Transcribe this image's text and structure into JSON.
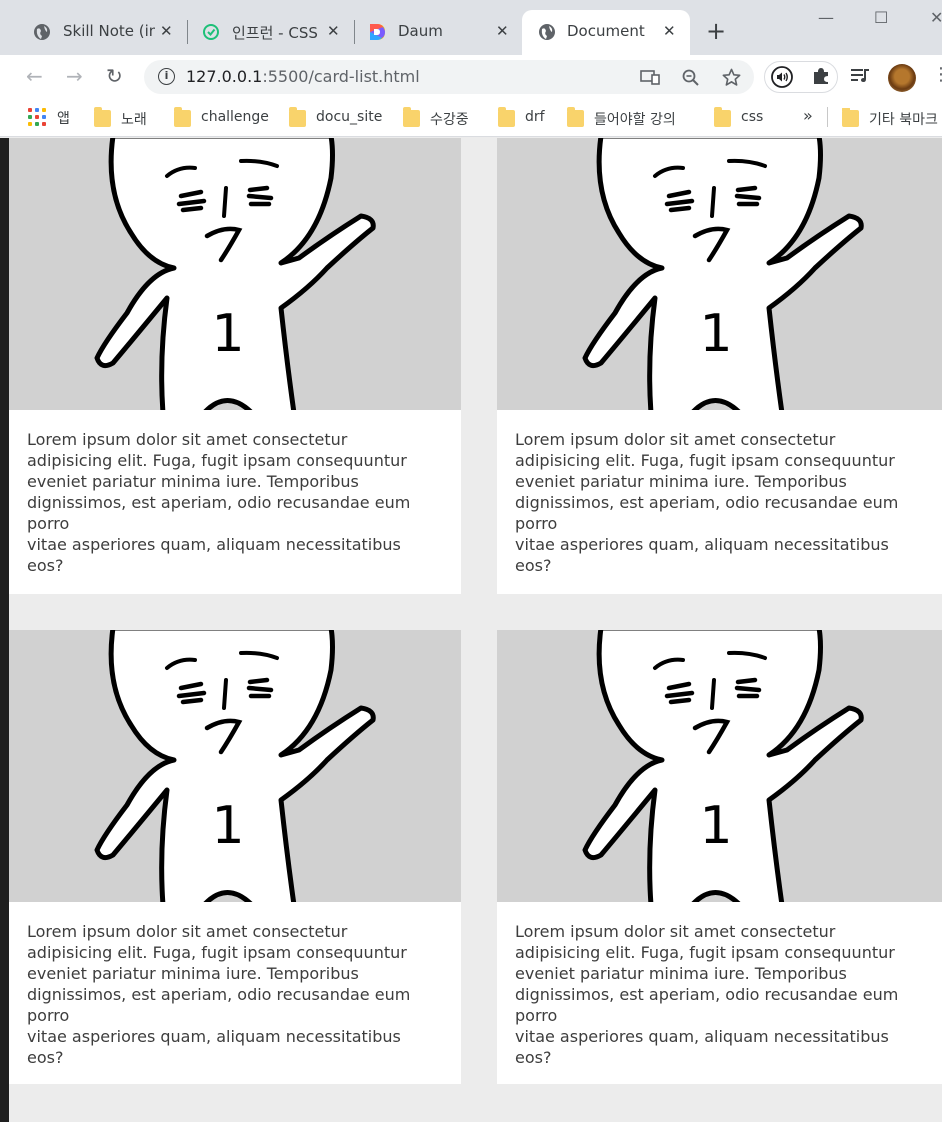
{
  "browser": {
    "tabs": [
      {
        "title": "Skill Note (in",
        "favicon": "globe-icon",
        "active": false
      },
      {
        "title": "인프런 - CSS",
        "favicon": "inflearn-icon",
        "active": false
      },
      {
        "title": "Daum",
        "favicon": "daum-icon",
        "active": false
      },
      {
        "title": "Document",
        "favicon": "globe-icon",
        "active": true
      }
    ],
    "new_tab": "+",
    "window_controls": {
      "minimize": "—",
      "maximize": "☐",
      "close": "✕"
    },
    "nav": {
      "back": "←",
      "forward": "→",
      "reload": "↻"
    },
    "address": {
      "host": "127.0.0.1",
      "rest": ":5500/card-list.html"
    },
    "bookmarks_bar": {
      "apps_label": "앱",
      "items": [
        "노래",
        "challenge",
        "docu_site",
        "수강중",
        "drf",
        "들어야할 강의",
        "css"
      ],
      "more": "»",
      "other": "기타 북마크"
    }
  },
  "page": {
    "cards": [
      {
        "lines": [
          "Lorem ipsum dolor sit amet consectetur",
          "adipisicing elit. Fuga, fugit ipsam consequuntur",
          "eveniet pariatur minima iure. Temporibus",
          "dignissimos, est aperiam, odio recusandae eum",
          "porro",
          "vitae asperiores quam, aliquam necessitatibus",
          "eos?"
        ],
        "figure_label": "1"
      },
      {
        "lines": [
          "Lorem ipsum dolor sit amet consectetur",
          "adipisicing elit. Fuga, fugit ipsam consequuntur",
          "eveniet pariatur minima iure. Temporibus",
          "dignissimos, est aperiam, odio recusandae eum",
          "porro",
          "vitae asperiores quam, aliquam necessitatibus",
          "eos?"
        ],
        "figure_label": "1"
      },
      {
        "lines": [
          "Lorem ipsum dolor sit amet consectetur",
          "adipisicing elit. Fuga, fugit ipsam consequuntur",
          "eveniet pariatur minima iure. Temporibus",
          "dignissimos, est aperiam, odio recusandae eum",
          "porro",
          "vitae asperiores quam, aliquam necessitatibus",
          "eos?"
        ],
        "figure_label": "1"
      },
      {
        "lines": [
          "Lorem ipsum dolor sit amet consectetur",
          "adipisicing elit. Fuga, fugit ipsam consequuntur",
          "eveniet pariatur minima iure. Temporibus",
          "dignissimos, est aperiam, odio recusandae eum",
          "porro",
          "vitae asperiores quam, aliquam necessitatibus",
          "eos?"
        ],
        "figure_label": "1"
      }
    ]
  },
  "colors": {
    "tabstrip": "#dee1e6",
    "page_bg": "#ececec",
    "image_bg": "#d1d1d1",
    "card_bg": "#ffffff",
    "text": "#3d3d3d"
  }
}
